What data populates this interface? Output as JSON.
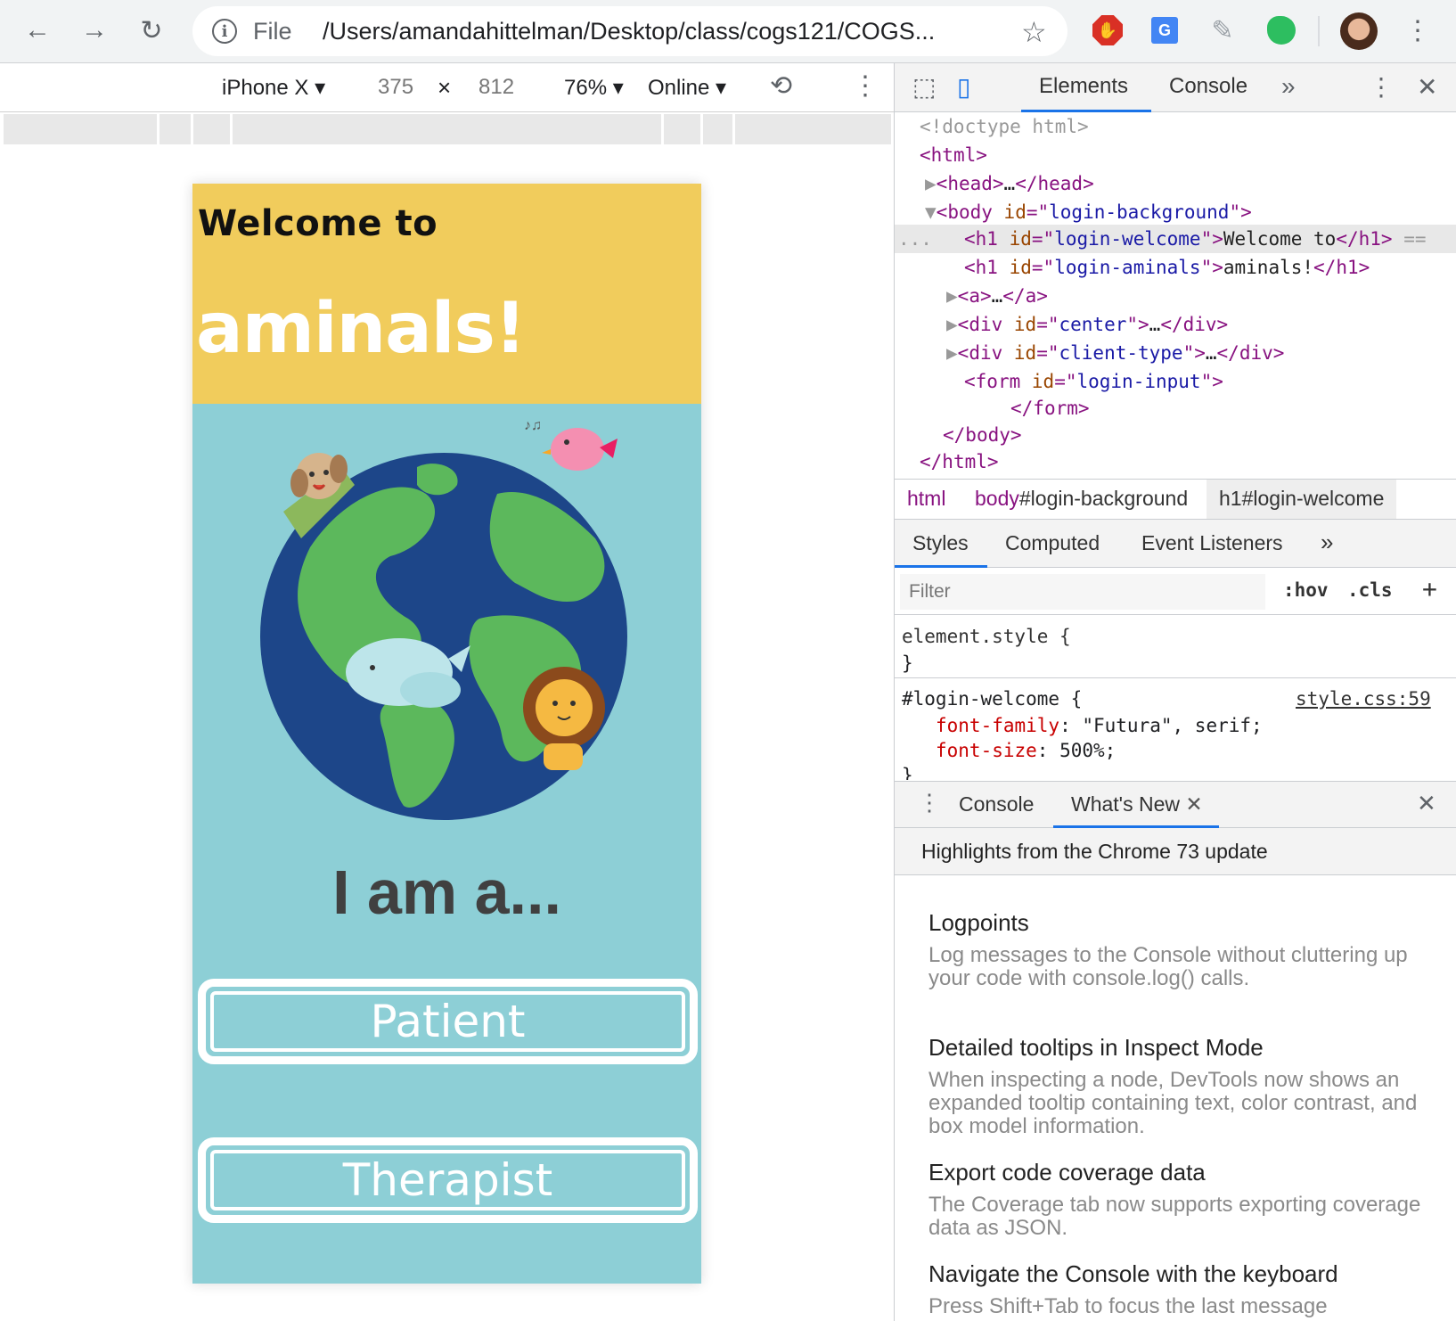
{
  "browser": {
    "scheme_label": "File",
    "url": "/Users/amandahittelman/Desktop/class/cogs121/COGS..."
  },
  "device_toolbar": {
    "device": "iPhone X",
    "width": "375",
    "times": "×",
    "height": "812",
    "zoom": "76%",
    "network": "Online"
  },
  "app": {
    "welcome": "Welcome to",
    "title": "aminals!",
    "prompt": "I am a...",
    "buttons": [
      "Patient",
      "Therapist"
    ],
    "colors": {
      "header": "#f1cc5c",
      "background": "#8dcfd6",
      "ocean": "#1d4689",
      "land": "#5cb85c"
    }
  },
  "devtools": {
    "tabs": [
      "Elements",
      "Console"
    ],
    "dom": {
      "doctype": "<!doctype html>",
      "html_open": "html",
      "head": "head",
      "ellipsis": "…",
      "body": "body",
      "id_attr": "id",
      "body_id": "login-background",
      "h1": "h1",
      "welcome_id": "login-welcome",
      "welcome_text": "Welcome to",
      "aminals_id": "login-aminals",
      "aminals_text": "aminals!",
      "a": "a",
      "div": "div",
      "center_id": "center",
      "client_id": "client-type",
      "form": "form",
      "form_id": "login-input",
      "eq": "==",
      "dots": "..."
    },
    "breadcrumbs": [
      "html",
      "body",
      "#login-background",
      "h1#login-welcome"
    ],
    "styles_tabs": [
      "Styles",
      "Computed",
      "Event Listeners"
    ],
    "filter_placeholder": "Filter",
    "filter_buttons": [
      ":hov",
      ".cls",
      "+"
    ],
    "rules": {
      "element_style": "element.style {",
      "close": "}",
      "selector": "#login-welcome {",
      "source": "style.css:59",
      "font_family_prop": "font-family",
      "font_family_val": ": \"Futura\", serif;",
      "font_size_prop": "font-size",
      "font_size_val": ": 500%;"
    },
    "drawer_tabs": [
      "Console",
      "What's New"
    ],
    "highlights": "Highlights from the Chrome 73 update",
    "news": [
      {
        "title": "Logpoints",
        "desc": "Log messages to the Console without cluttering up your code with console.log() calls."
      },
      {
        "title": "Detailed tooltips in Inspect Mode",
        "desc": "When inspecting a node, DevTools now shows an expanded tooltip containing text, color contrast, and box model information."
      },
      {
        "title": "Export code coverage data",
        "desc": "The Coverage tab now supports exporting coverage data as JSON."
      },
      {
        "title": "Navigate the Console with the keyboard",
        "desc": "Press Shift+Tab to focus the last message"
      }
    ]
  }
}
